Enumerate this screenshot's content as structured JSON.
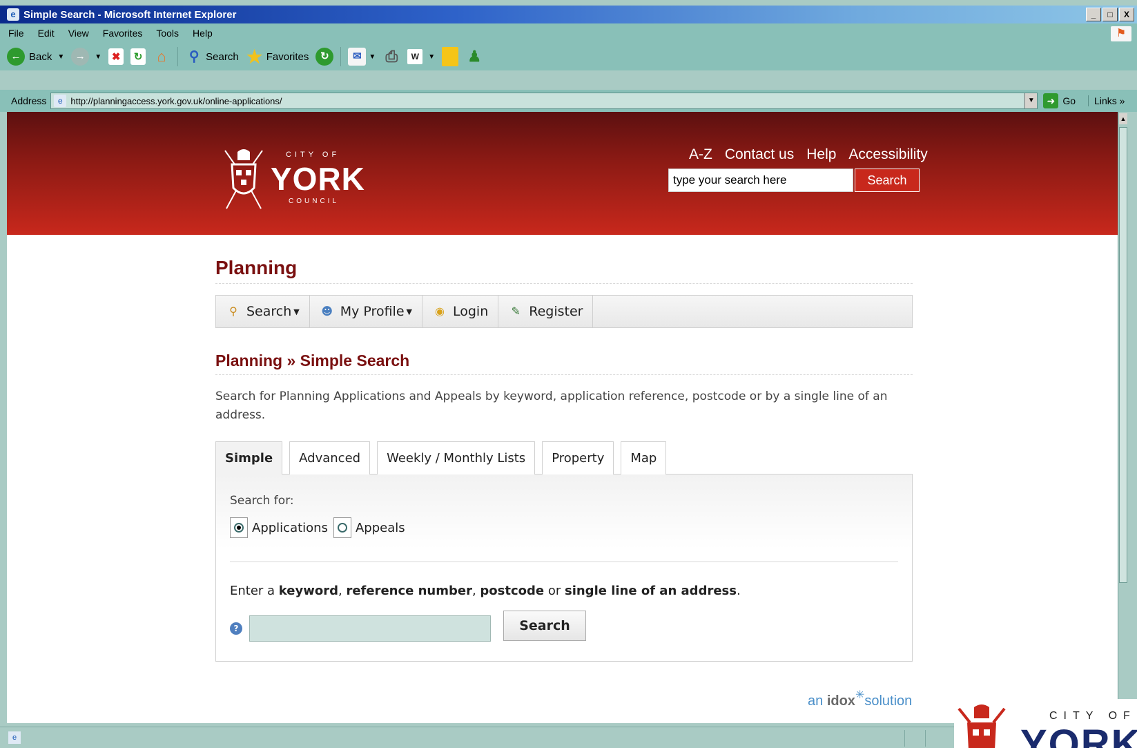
{
  "window": {
    "title": "Simple Search - Microsoft Internet Explorer",
    "buttons": [
      "_",
      "□",
      "X"
    ]
  },
  "menubar": [
    "File",
    "Edit",
    "View",
    "Favorites",
    "Tools",
    "Help"
  ],
  "toolbar": {
    "back": "Back",
    "search": "Search",
    "favorites": "Favorites"
  },
  "address": {
    "label": "Address",
    "url": "http://planningaccess.york.gov.uk/online-applications/",
    "go": "Go",
    "links": "Links"
  },
  "site_header": {
    "logo_city_of": "CITY OF",
    "logo_name": "YORK",
    "logo_council": "COUNCIL",
    "links": [
      "A-Z",
      "Contact us",
      "Help",
      "Accessibility"
    ],
    "search_placeholder": "type your search here",
    "search_button": "Search"
  },
  "content": {
    "title": "Planning",
    "nav": {
      "search": "Search",
      "my_profile": "My Profile",
      "login": "Login",
      "register": "Register"
    },
    "breadcrumb": "Planning » Simple Search",
    "intro": "Search for Planning Applications and Appeals by keyword, application reference, postcode or by a single line of an address.",
    "tabs": [
      "Simple",
      "Advanced",
      "Weekly / Monthly Lists",
      "Property",
      "Map"
    ],
    "active_tab": "Simple",
    "search_for_label": "Search for:",
    "radio_options": [
      {
        "label": "Applications",
        "selected": true
      },
      {
        "label": "Appeals",
        "selected": false
      }
    ],
    "enter_parts": {
      "p1": "Enter a ",
      "b1": "keyword",
      "p2": ", ",
      "b2": "reference number",
      "p3": ", ",
      "b3": "postcode",
      "p4": " or ",
      "b4": "single line of an address",
      "p5": "."
    },
    "search_value": "",
    "search_button": "Search"
  },
  "footer": {
    "idox_an": "an",
    "idox_brand": "idox",
    "idox_solution": "solution"
  },
  "corner_logo": {
    "city_of": "CITY OF",
    "name": "YORK"
  },
  "colors": {
    "header_red": "#c8281c",
    "heading_maroon": "#7a1010",
    "ie_chrome": "#89c0b8"
  }
}
